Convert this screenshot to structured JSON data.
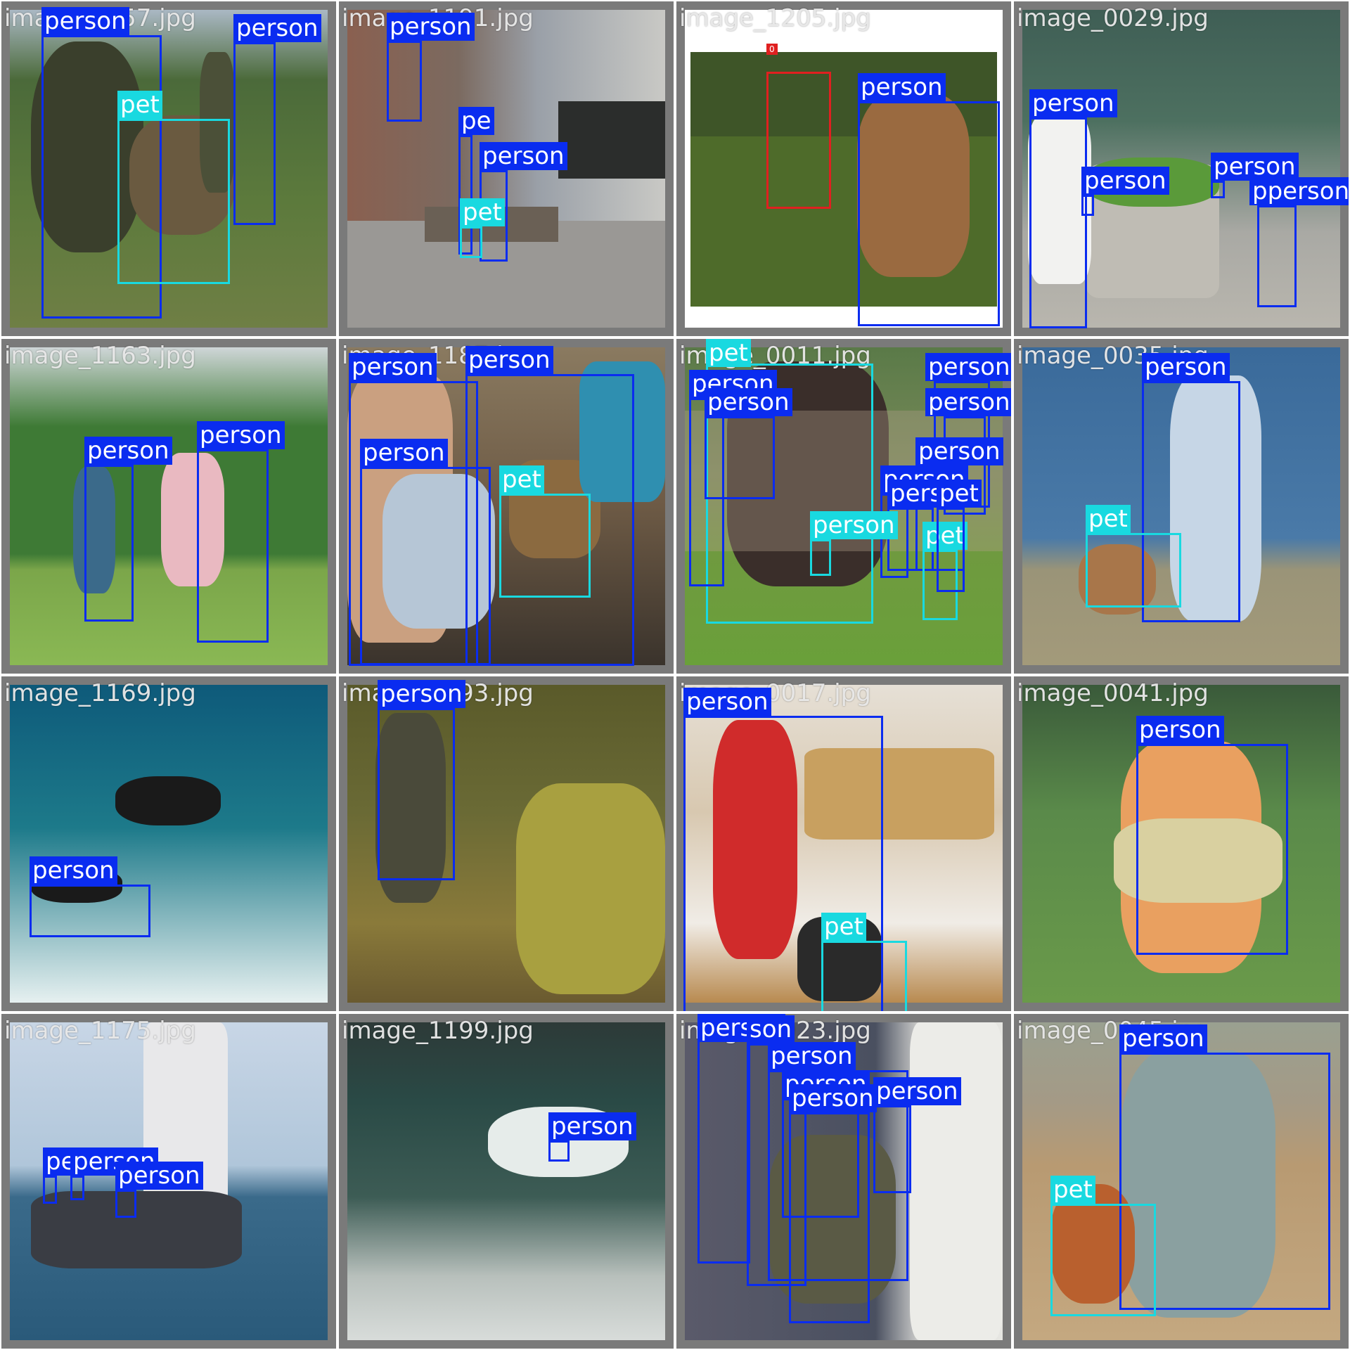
{
  "colors": {
    "person": "#0a2cf0",
    "pet": "#19d9e0",
    "other": "#e02020",
    "background": "#7a7a7a"
  },
  "tiles": [
    {
      "filename": "image_0057.jpg",
      "labels": [
        "person",
        "person",
        "pet"
      ]
    },
    {
      "filename": "image_1191.jpg",
      "labels": [
        "person",
        "pe",
        "person",
        "pet"
      ]
    },
    {
      "filename": "image_1205.jpg",
      "labels": [
        "person",
        "0"
      ]
    },
    {
      "filename": "image_0029.jpg",
      "labels": [
        "person",
        "person",
        "person",
        "pperson"
      ]
    },
    {
      "filename": "image_1163.jpg",
      "labels": [
        "person",
        "person"
      ]
    },
    {
      "filename": "image_1187.jpg",
      "labels": [
        "person",
        "person",
        "person",
        "pet"
      ]
    },
    {
      "filename": "image_0011.jpg",
      "labels": [
        "pet",
        "person",
        "person",
        "person",
        "person",
        "person",
        "person",
        "person",
        "person",
        "pet",
        "pet"
      ]
    },
    {
      "filename": "image_0035.jpg",
      "labels": [
        "person",
        "pet"
      ]
    },
    {
      "filename": "image_1169.jpg",
      "labels": [
        "person"
      ]
    },
    {
      "filename": "image_1193.jpg",
      "labels": [
        "person"
      ]
    },
    {
      "filename": "image_0017.jpg",
      "labels": [
        "person",
        "pet"
      ]
    },
    {
      "filename": "image_0041.jpg",
      "labels": [
        "person"
      ]
    },
    {
      "filename": "image_1175.jpg",
      "labels": [
        "pe",
        "person",
        "person"
      ]
    },
    {
      "filename": "image_1199.jpg",
      "labels": [
        "person"
      ]
    },
    {
      "filename": "image_0023.jpg",
      "labels": [
        "person",
        "son",
        "person",
        "person",
        "person",
        "person"
      ]
    },
    {
      "filename": "image_0045.jpg",
      "labels": [
        "person",
        "pet"
      ]
    }
  ]
}
